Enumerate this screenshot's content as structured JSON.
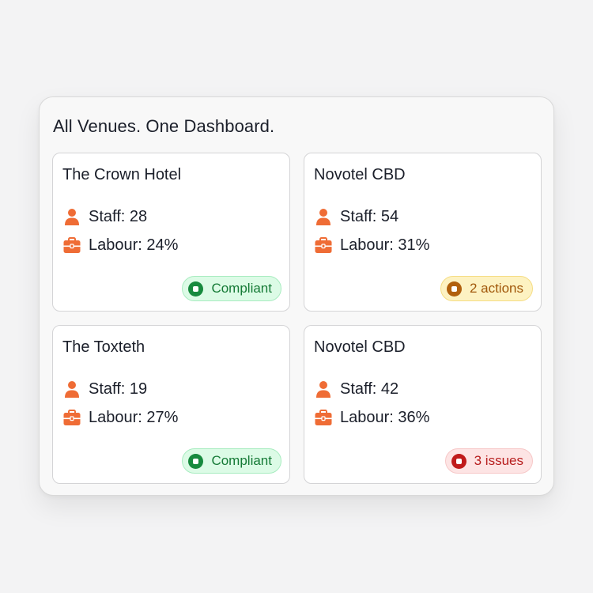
{
  "dashboard": {
    "title": "All Venues. One Dashboard.",
    "accent_color": "#ef6c35",
    "venues": [
      {
        "name": "The Crown Hotel",
        "staff": "Staff: 28",
        "labour": "Labour: 24%",
        "status": {
          "label": "Compliant",
          "kind": "ok",
          "color": "#178a3e"
        }
      },
      {
        "name": "Novotel CBD",
        "staff": "Staff: 54",
        "labour": "Labour: 31%",
        "status": {
          "label": "2 actions",
          "kind": "warn",
          "color": "#b1600d"
        }
      },
      {
        "name": "The Toxteth",
        "staff": "Staff: 19",
        "labour": "Labour: 27%",
        "status": {
          "label": "Compliant",
          "kind": "ok",
          "color": "#178a3e"
        }
      },
      {
        "name": "Novotel CBD",
        "staff": "Staff: 42",
        "labour": "Labour: 36%",
        "status": {
          "label": "3 issues",
          "kind": "bad",
          "color": "#c01b1b"
        }
      }
    ],
    "icons": {
      "staff": "person-icon",
      "labour": "briefcase-icon",
      "status": "status-dot-icon"
    }
  }
}
